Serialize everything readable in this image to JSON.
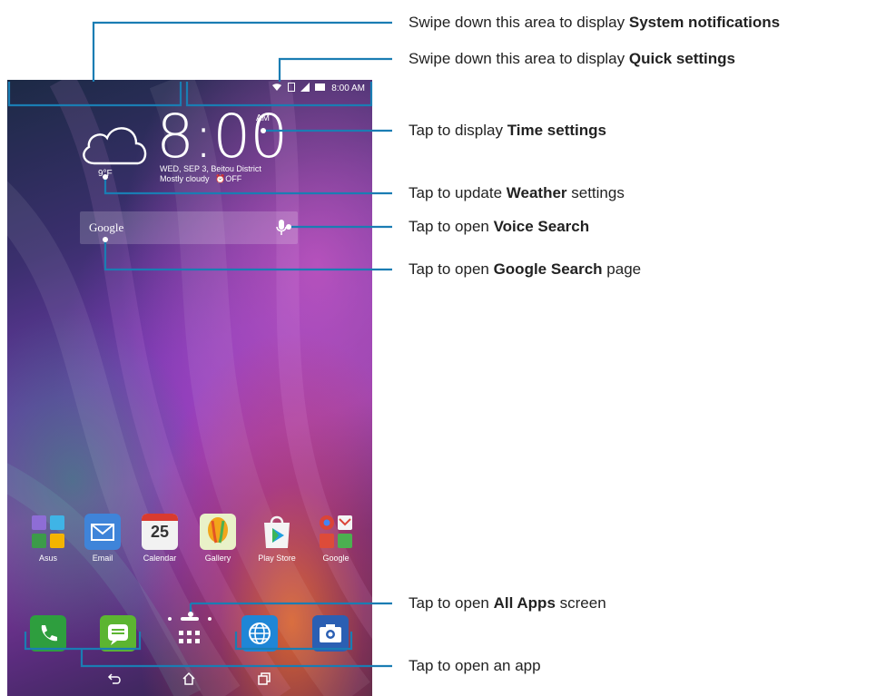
{
  "status_bar": {
    "time": "8:00 AM"
  },
  "clock_widget": {
    "time": "8:00",
    "ampm": "AM",
    "date_location": "WED, SEP 3, Beitou District",
    "condition": "Mostly cloudy",
    "alarm": "OFF",
    "temperature": "9°F"
  },
  "search_bar": {
    "label": "Google"
  },
  "apps": [
    {
      "label": "Asus"
    },
    {
      "label": "Email"
    },
    {
      "label": "Calendar",
      "badge": "25"
    },
    {
      "label": "Gallery"
    },
    {
      "label": "Play Store"
    },
    {
      "label": "Google"
    }
  ],
  "callouts": {
    "system_notifications": {
      "pre": "Swipe down this area to display ",
      "bold": "System notifications",
      "post": ""
    },
    "quick_settings": {
      "pre": "Swipe down this area to display ",
      "bold": "Quick settings",
      "post": ""
    },
    "time_settings": {
      "pre": "Tap to display ",
      "bold": "Time settings",
      "post": ""
    },
    "weather": {
      "pre": "Tap to update ",
      "bold": "Weather",
      "post": " settings"
    },
    "voice_search": {
      "pre": "Tap to open ",
      "bold": "Voice Search",
      "post": ""
    },
    "google_search": {
      "pre": "Tap to open ",
      "bold": "Google Search",
      "post": " page"
    },
    "all_apps": {
      "pre": "Tap to open ",
      "bold": "All Apps",
      "post": " screen"
    },
    "open_app": {
      "pre": "Tap to open an app",
      "bold": "",
      "post": ""
    }
  },
  "colors": {
    "callout_line": "#1a7db3",
    "phone_green": "#2e9e3e",
    "messaging_green": "#5cb531",
    "browser_blue": "#1f86d6",
    "camera_blue": "#2b5fb3",
    "email_blue": "#3f84d9"
  }
}
